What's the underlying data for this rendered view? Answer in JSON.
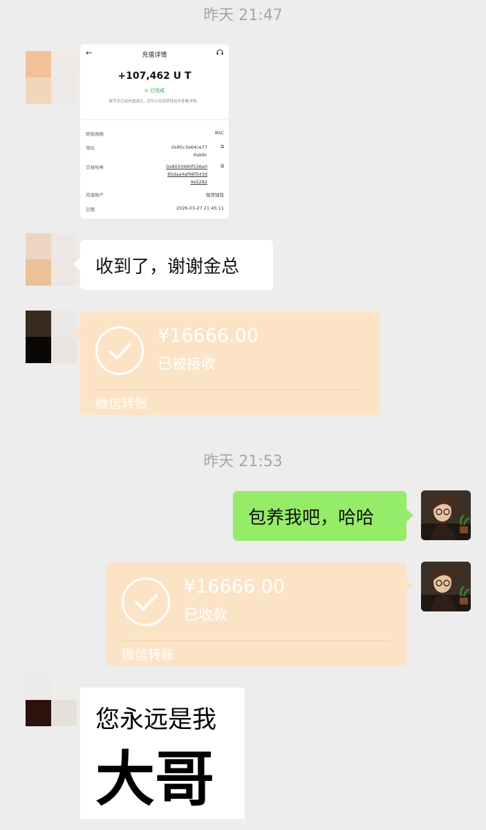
{
  "timestamps": [
    "昨天 21:47",
    "昨天 21:53"
  ],
  "screenshot_card": {
    "title": "充值详情",
    "amount": "+107,462 U  T",
    "status": "已完成",
    "note": "数字币已经充值成功，您可以在现货钱包中查看详情。",
    "rows": [
      {
        "key": "转账网络",
        "value": "BSC"
      },
      {
        "key": "地址",
        "value": "0x85c3e64ce77\n6ab9c"
      },
      {
        "key": "交易哈希",
        "value": "0x8033990f536e0\n85daa4af98f543d\n4e5282"
      },
      {
        "key": "充值账户",
        "value": "现货钱包"
      },
      {
        "key": "日期",
        "value": "2026-03-27 21:45:11"
      }
    ]
  },
  "messages": {
    "reply_text": "收到了，谢谢金总",
    "my_text": "包养我吧，哈哈"
  },
  "transfer_received": {
    "amount": "¥16666.00",
    "status": "已被接收",
    "label": "微信转账"
  },
  "transfer_sent": {
    "amount": "¥16666.00",
    "status": "已收款",
    "label": "微信转账"
  },
  "sticker": {
    "line1": "您永远是我",
    "line2": "大哥"
  },
  "colors": {
    "background": "#ededed",
    "my_bubble": "#95ec69",
    "transfer_card": "#fde3c6",
    "time_text": "#a6a6a6"
  },
  "icons": [
    "back-arrow-icon",
    "headset-icon",
    "check-circle-icon",
    "copy-icon"
  ]
}
